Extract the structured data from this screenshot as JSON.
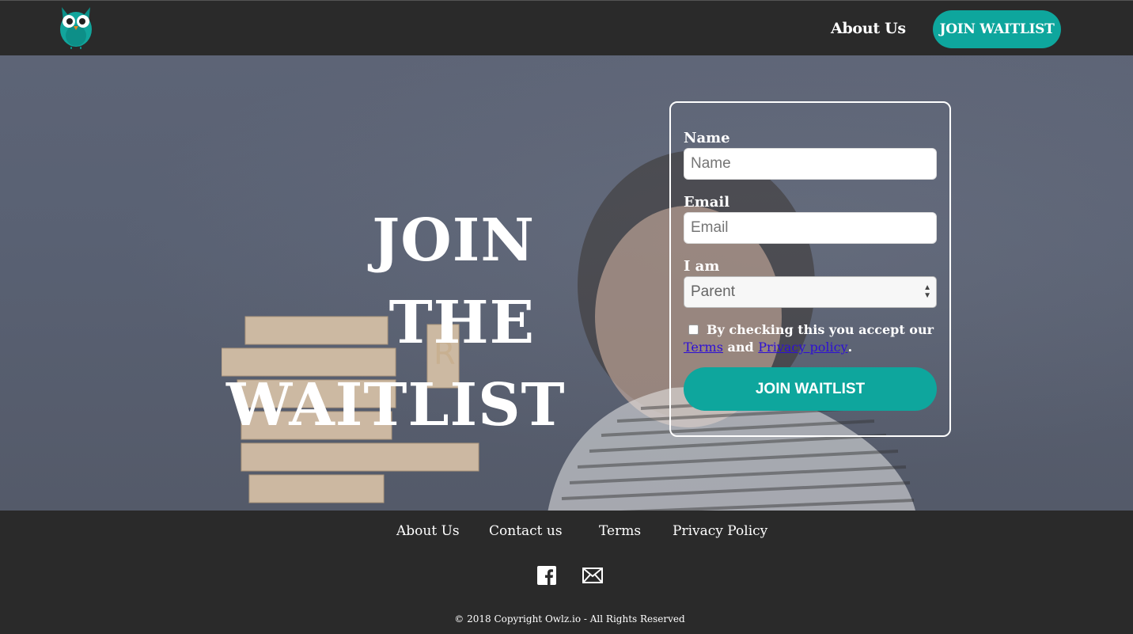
{
  "header": {
    "nav_about": "About Us",
    "nav_join": "JOIN WAITLIST"
  },
  "hero": {
    "title_line1": "JOIN THE",
    "title_line2": "WAITLIST"
  },
  "form": {
    "name_label": "Name",
    "name_placeholder": "Name",
    "email_label": "Email",
    "email_placeholder": "Email",
    "role_label": "I am",
    "role_selected": "Parent",
    "consent_text": "By checking this you accept our",
    "terms_link": "Terms",
    "and_text": "and",
    "privacy_link": "Privacy policy",
    "period": ".",
    "submit_label": "JOIN WAITLIST"
  },
  "footer": {
    "links": [
      "About Us",
      "Contact us",
      "Terms",
      "Privacy Policy"
    ],
    "icons": [
      "facebook-icon",
      "mail-icon"
    ],
    "copyright": "© 2018 Copyright Owlz.io - All Rights Reserved"
  },
  "colors": {
    "accent": "#0ea69d",
    "header_bg": "#2a2a2a",
    "link": "#2d0fd6"
  }
}
